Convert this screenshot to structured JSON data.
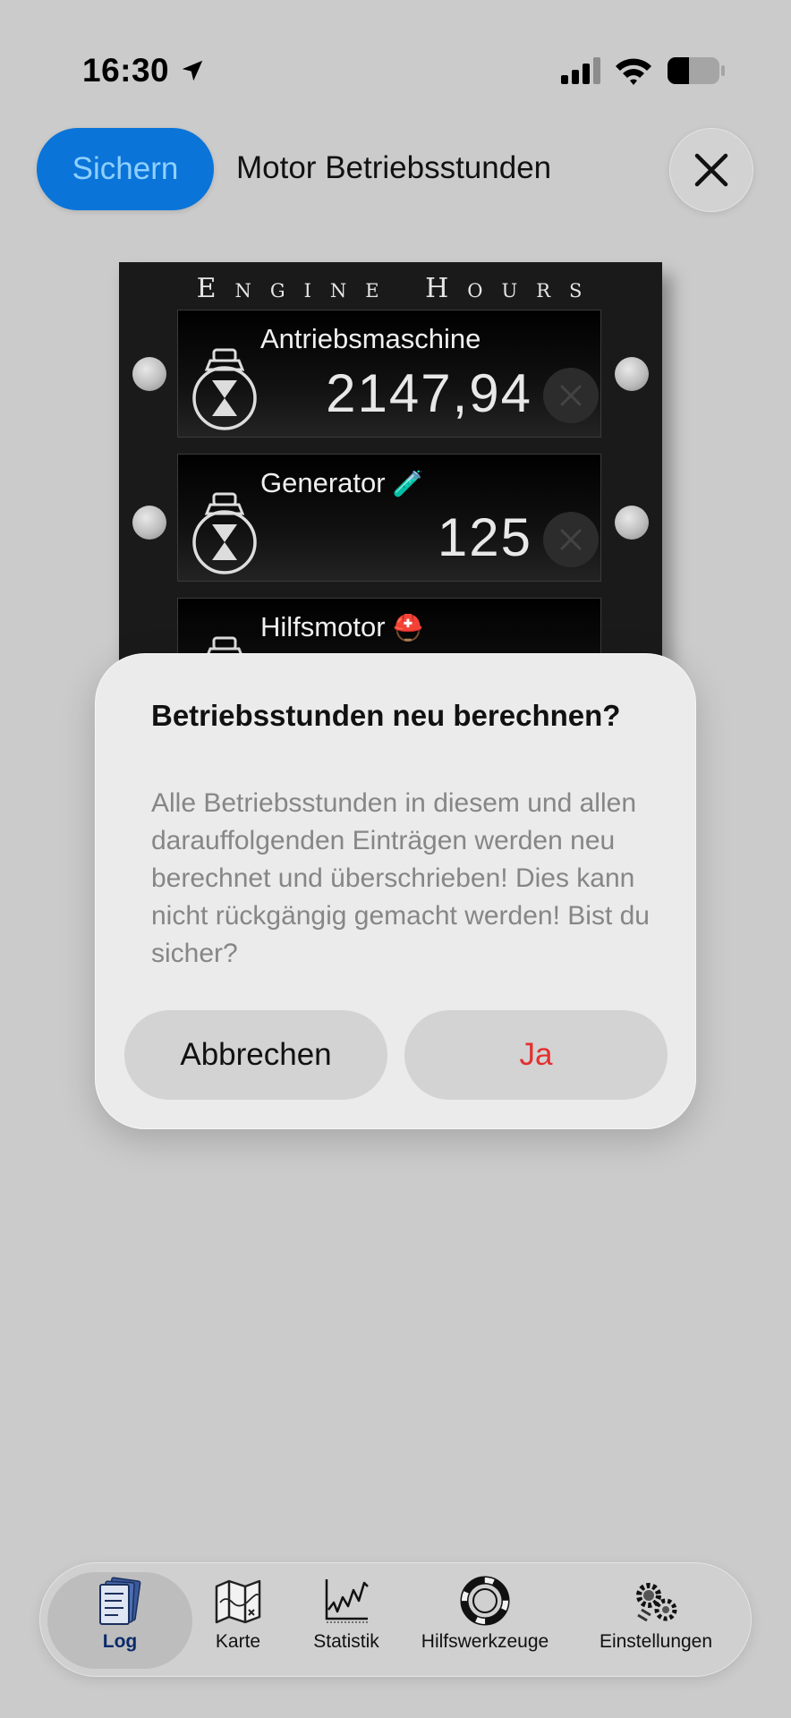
{
  "status_bar": {
    "time": "16:30",
    "icons": [
      "location-arrow-icon",
      "cellular-signal-icon",
      "wifi-icon",
      "battery-icon"
    ],
    "battery_level": 0.4
  },
  "header": {
    "save_label": "Sichern",
    "title": "Motor Betriebsstunden",
    "close_icon": "close-icon"
  },
  "engine_panel": {
    "title": "Engine Hours",
    "engines": [
      {
        "name": "Antriebsmaschine",
        "badge": "",
        "hours": "2147,94"
      },
      {
        "name": "Generator",
        "badge": "🧪",
        "hours": "125"
      },
      {
        "name": "Hilfsmotor",
        "badge": "⛑️",
        "hours": ""
      }
    ]
  },
  "alert": {
    "title": "Betriebsstunden neu berechnen?",
    "message": "Alle Betriebsstunden in diesem und allen darauffolgenden Einträgen werden neu berechnet und überschrieben! Dies kann nicht rückgängig gemacht werden! Bist du sicher?",
    "cancel_label": "Abbrechen",
    "confirm_label": "Ja",
    "confirm_color": "#e3302f"
  },
  "tab_bar": {
    "tabs": [
      {
        "label": "Log",
        "icon": "logbook-icon",
        "active": true
      },
      {
        "label": "Karte",
        "icon": "map-icon",
        "active": false
      },
      {
        "label": "Statistik",
        "icon": "chart-icon",
        "active": false
      },
      {
        "label": "Hilfswerkzeuge",
        "icon": "lifebuoy-icon",
        "active": false
      },
      {
        "label": "Einstellungen",
        "icon": "gears-icon",
        "active": false
      }
    ]
  },
  "colors": {
    "accent": "#0a74d9",
    "background": "#cbcbcb",
    "destructive": "#e3302f"
  }
}
